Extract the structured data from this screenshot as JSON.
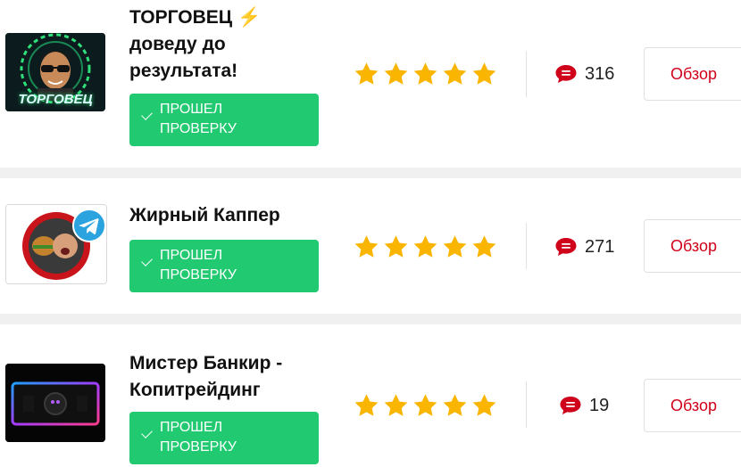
{
  "colors": {
    "verified_bg": "#21c970",
    "star": "#f9b500",
    "comment_icon": "#d0021b",
    "review_text": "#d0021b"
  },
  "listings": [
    {
      "title_line1": "ТОРГОВЕЦ ⚡",
      "title_line2": "доведу до",
      "title_line3": "результата!",
      "verified_line1": "ПРОШЕЛ",
      "verified_line2": "ПРОВЕРКУ",
      "rating": 5,
      "comments": "316",
      "review_label": "Обзор",
      "avatar_text": "ТОРГОВЕЦ",
      "avatar_icon": "trader-logo-icon"
    },
    {
      "title_line1": "Жирный Каппер",
      "verified_line1": "ПРОШЕЛ",
      "verified_line2": "ПРОВЕРКУ",
      "rating": 5,
      "comments": "271",
      "review_label": "Обзор",
      "avatar_icon": "telegram-icon"
    },
    {
      "title_line1": "Мистер Банкир -",
      "title_line2": "Копитрейдинг",
      "verified_line1": "ПРОШЕЛ",
      "verified_line2": "ПРОВЕРКУ",
      "rating": 5,
      "comments": "19",
      "review_label": "Обзор",
      "avatar_icon": "banker-logo-icon"
    }
  ]
}
